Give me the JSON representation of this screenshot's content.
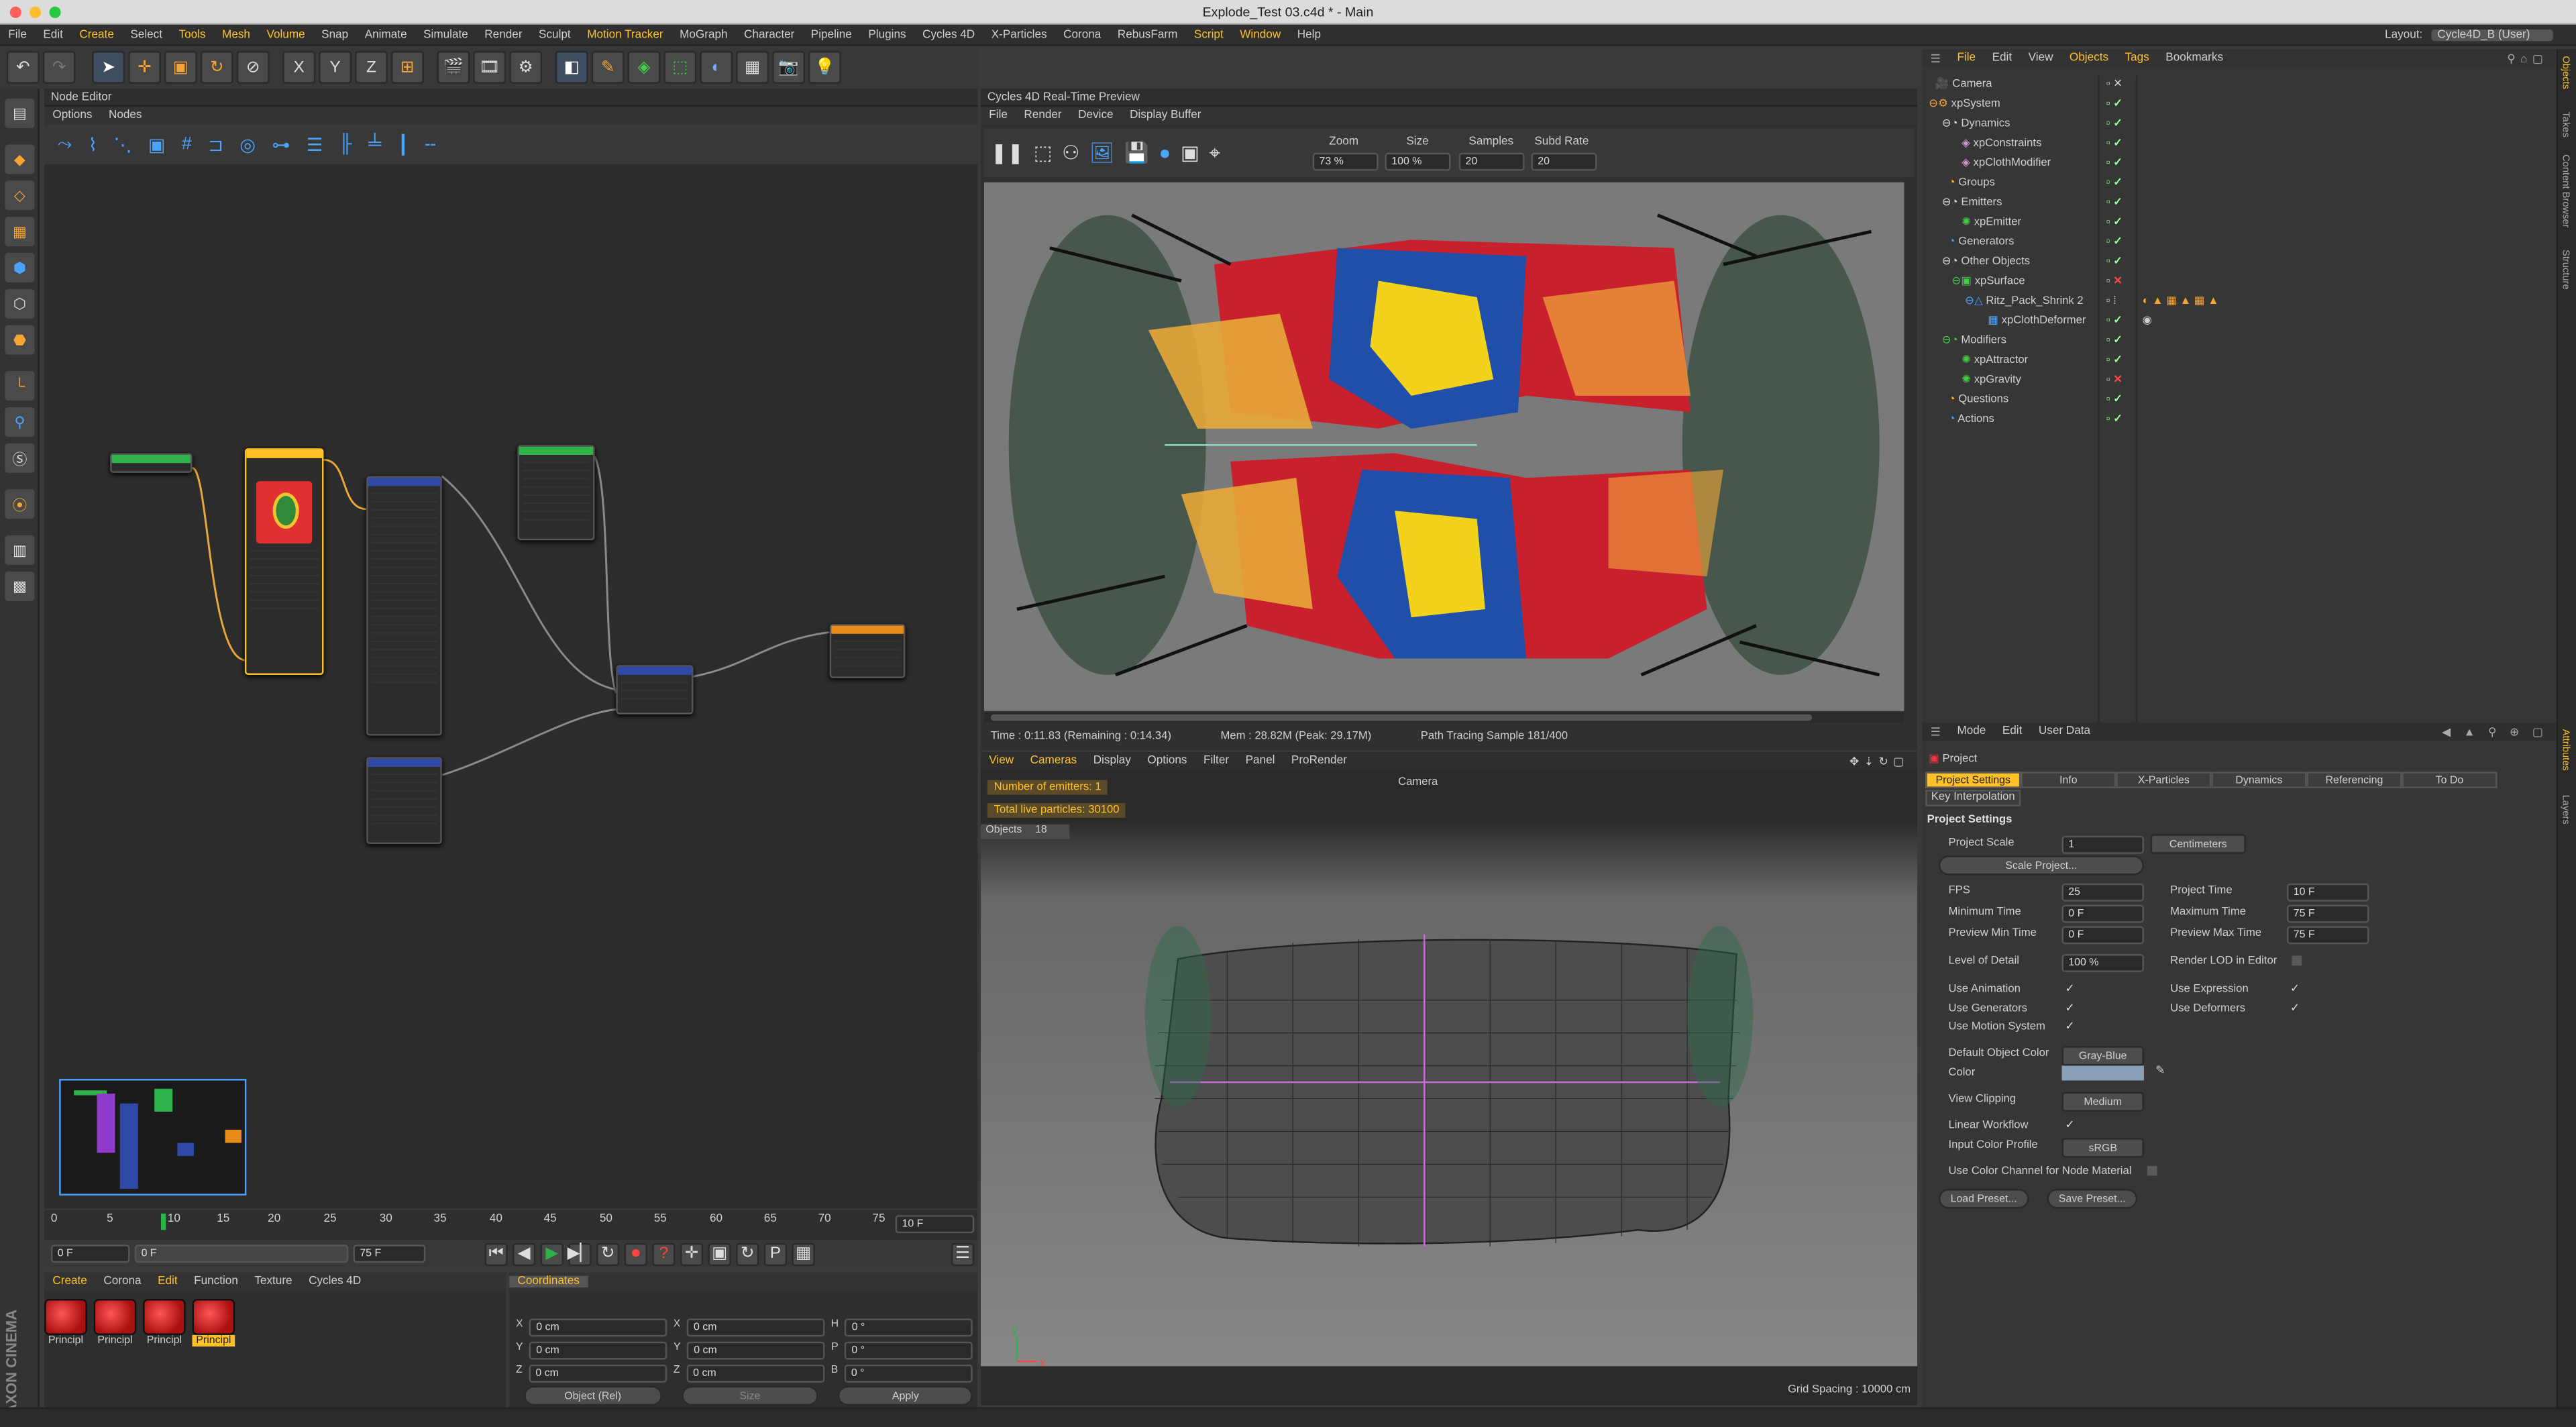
{
  "window": {
    "title": "Explode_Test 03.c4d * - Main"
  },
  "menubar": {
    "items": [
      "File",
      "Edit",
      "Create",
      "Select",
      "Tools",
      "Mesh",
      "Volume",
      "Snap",
      "Animate",
      "Simulate",
      "Render",
      "Sculpt",
      "Motion Tracker",
      "MoGraph",
      "Character",
      "Pipeline",
      "Plugins",
      "Cycles 4D",
      "X-Particles",
      "Corona",
      "RebusFarm",
      "Script",
      "Window",
      "Help"
    ],
    "layout_label": "Layout:",
    "layout_value": "Cycle4D_B (User)"
  },
  "toolbar": {
    "icons": [
      "undo-icon",
      "move-icon",
      "scale-icon",
      "rotate-icon",
      "live-select-icon",
      "x-axis-icon",
      "y-axis-icon",
      "z-axis-icon",
      "coordinate-system-icon",
      "render-view-icon",
      "render-picture-viewer-icon",
      "render-settings-icon",
      "cube-icon",
      "pen-icon",
      "subdivision-icon",
      "array-icon",
      "deformer-icon",
      "floor-icon",
      "camera-icon",
      "light-icon"
    ],
    "axis_labels": [
      "X",
      "Y",
      "Z"
    ]
  },
  "node_editor": {
    "title": "Node Editor",
    "submenu": [
      "Options",
      "Nodes"
    ]
  },
  "render_preview": {
    "title": "Cycles 4D Real-Time Preview",
    "menu": [
      "File",
      "Render",
      "Device",
      "Display Buffer"
    ],
    "zoom_label": "Zoom",
    "zoom_value": "73 %",
    "size_label": "Size",
    "size_value": "100 %",
    "samples_label": "Samples",
    "samples_value": "20",
    "subd_label": "Subd Rate",
    "subd_value": "20",
    "status_time": "Time : 0:11.83 (Remaining : 0:14.34)",
    "status_mem": "Mem : 28.82M (Peak: 29.17M)",
    "status_sample": "Path Tracing Sample 181/400"
  },
  "viewport": {
    "menu": [
      "View",
      "Cameras",
      "Display",
      "Options",
      "Filter",
      "Panel",
      "ProRender"
    ],
    "camera": "Camera",
    "hud_emitters": "Number of emitters: 1",
    "hud_particles": "Total live particles: 30100",
    "hud_objects_label": "Objects",
    "hud_objects_value": "18",
    "grid_spacing": "Grid Spacing : 10000 cm"
  },
  "timeline": {
    "ticks": [
      "0",
      "5",
      "10",
      "15",
      "20",
      "25",
      "30",
      "35",
      "40",
      "45",
      "50",
      "55",
      "60",
      "65",
      "70",
      "75"
    ],
    "current_frame": "10 F",
    "start_field": "0 F",
    "range_field": "0 F",
    "end_field1": "75 F",
    "end_field2": "75 F"
  },
  "material_manager": {
    "menu": [
      "Create",
      "Corona",
      "Edit",
      "Function",
      "Texture",
      "Cycles 4D"
    ],
    "materials": [
      "Principl",
      "Principl",
      "Principl",
      "Principl"
    ]
  },
  "coordinates": {
    "title": "Coordinates",
    "x_pos": "0 cm",
    "y_pos": "0 cm",
    "z_pos": "0 cm",
    "x_size": "0 cm",
    "y_size": "0 cm",
    "z_size": "0 cm",
    "h": "0 °",
    "p": "0 °",
    "b": "0 °",
    "mode": "Object (Rel)",
    "size_mode": "Size",
    "apply": "Apply"
  },
  "object_manager": {
    "menu": [
      "File",
      "Edit",
      "View",
      "Objects",
      "Tags",
      "Bookmarks"
    ],
    "objects": [
      {
        "name": "Camera",
        "depth": 0
      },
      {
        "name": "xpSystem",
        "depth": 0
      },
      {
        "name": "Dynamics",
        "depth": 1
      },
      {
        "name": "xpConstraints",
        "depth": 2
      },
      {
        "name": "xpClothModifier",
        "depth": 2
      },
      {
        "name": "Groups",
        "depth": 1
      },
      {
        "name": "Emitters",
        "depth": 1
      },
      {
        "name": "xpEmitter",
        "depth": 2
      },
      {
        "name": "Generators",
        "depth": 1
      },
      {
        "name": "Other Objects",
        "depth": 1
      },
      {
        "name": "xpSurface",
        "depth": 2
      },
      {
        "name": "Ritz_Pack_Shrink 2",
        "depth": 3
      },
      {
        "name": "xpClothDeformer",
        "depth": 4
      },
      {
        "name": "Modifiers",
        "depth": 1
      },
      {
        "name": "xpAttractor",
        "depth": 2
      },
      {
        "name": "xpGravity",
        "depth": 2
      },
      {
        "name": "Questions",
        "depth": 1
      },
      {
        "name": "Actions",
        "depth": 1
      }
    ]
  },
  "attributes": {
    "menu": [
      "Mode",
      "Edit",
      "User Data"
    ],
    "object": "Project",
    "tabs": [
      "Project Settings",
      "Info",
      "X-Particles",
      "Dynamics",
      "Referencing",
      "To Do"
    ],
    "subtab": "Key Interpolation",
    "section": "Project Settings",
    "project_scale_label": "Project Scale",
    "project_scale": "1",
    "units": "Centimeters",
    "scale_project_btn": "Scale Project...",
    "fps_label": "FPS",
    "fps": "25",
    "project_time_label": "Project Time",
    "project_time": "10 F",
    "min_time_label": "Minimum Time",
    "min_time": "0 F",
    "max_time_label": "Maximum Time",
    "max_time": "75 F",
    "prev_min_label": "Preview Min Time",
    "prev_min": "0 F",
    "prev_max_label": "Preview Max Time",
    "prev_max": "75 F",
    "lod_label": "Level of Detail",
    "lod": "100 %",
    "render_lod_label": "Render LOD in Editor",
    "use_anim": "Use Animation",
    "use_expr": "Use Expression",
    "use_gen": "Use Generators",
    "use_def": "Use Deformers",
    "use_motion": "Use Motion System",
    "default_color_label": "Default Object Color",
    "default_color": "Gray-Blue",
    "color_label": "Color",
    "view_clip_label": "View Clipping",
    "view_clip": "Medium",
    "linear_label": "Linear Workflow",
    "input_profile_label": "Input Color Profile",
    "input_profile": "sRGB",
    "node_channel_label": "Use Color Channel for Node Material",
    "load_preset": "Load Preset...",
    "save_preset": "Save Preset..."
  },
  "right_edge_tabs": [
    "Objects",
    "Takes",
    "Content Browser",
    "Structure",
    "Attributes",
    "Layers"
  ],
  "colors": {
    "accent": "#ffc125",
    "blue": "#4aa3ff",
    "panel": "#363636"
  }
}
